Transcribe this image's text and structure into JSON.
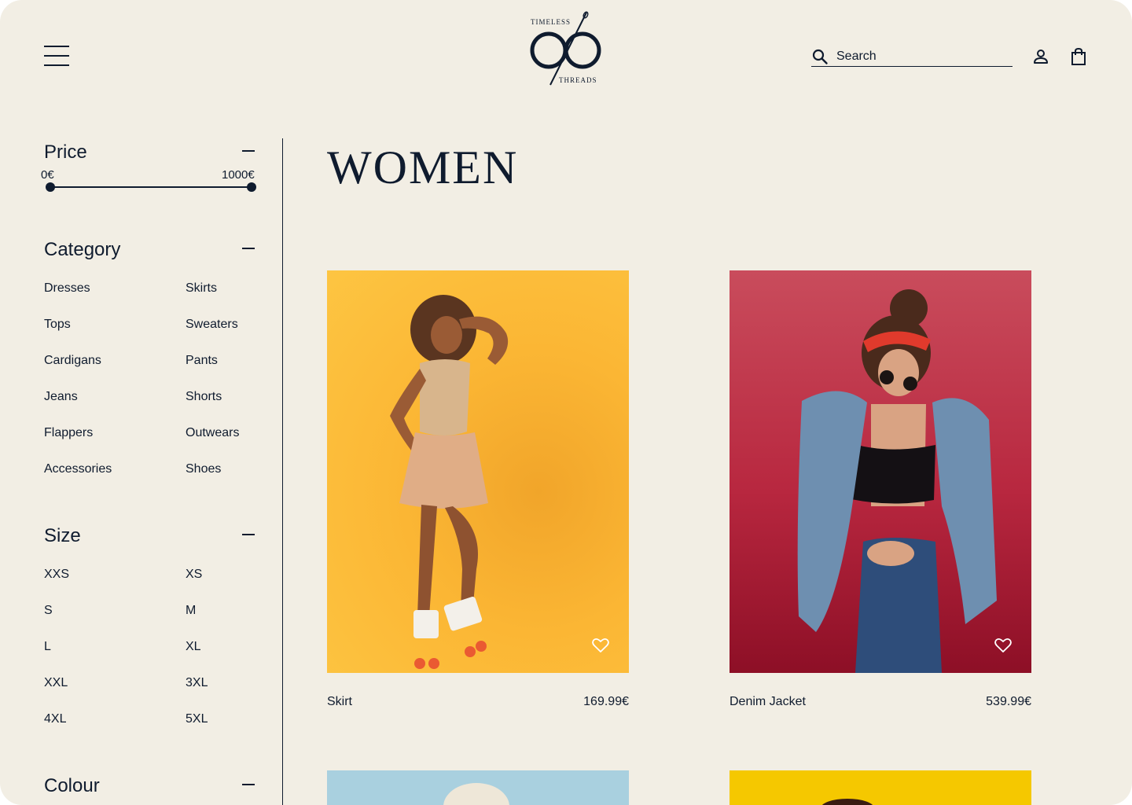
{
  "brand": {
    "logo_top": "TIMELESS",
    "logo_bottom": "THREADS"
  },
  "search": {
    "placeholder": "Search"
  },
  "header": {
    "menu_icon": "hamburger-menu-icon",
    "account_icon": "user-icon",
    "bag_icon": "shopping-bag-icon"
  },
  "filters": {
    "price": {
      "title": "Price",
      "min_label": "0€",
      "max_label": "1000€",
      "min_value": 0,
      "max_value": 1000
    },
    "category": {
      "title": "Category",
      "options": [
        "Dresses",
        "Skirts",
        "Tops",
        "Sweaters",
        "Cardigans",
        "Pants",
        "Jeans",
        "Shorts",
        "Flappers",
        "Outwears",
        "Accessories",
        "Shoes"
      ]
    },
    "size": {
      "title": "Size",
      "options": [
        "XXS",
        "XS",
        "S",
        "M",
        "L",
        "XL",
        "XXL",
        "3XL",
        "4XL",
        "5XL"
      ]
    },
    "colour": {
      "title": "Colour"
    }
  },
  "main": {
    "title": "WOMEN",
    "products": [
      {
        "name": "Skirt",
        "price": "169.99€"
      },
      {
        "name": "Denim Jacket",
        "price": "539.99€"
      }
    ]
  },
  "colors": {
    "background": "#f2eee4",
    "ink": "#0f1b2e",
    "tile_yellow": "#fbb634",
    "tile_red": "#b8273f",
    "tile_blue": "#a9d0df",
    "tile_gold": "#f5c800"
  }
}
